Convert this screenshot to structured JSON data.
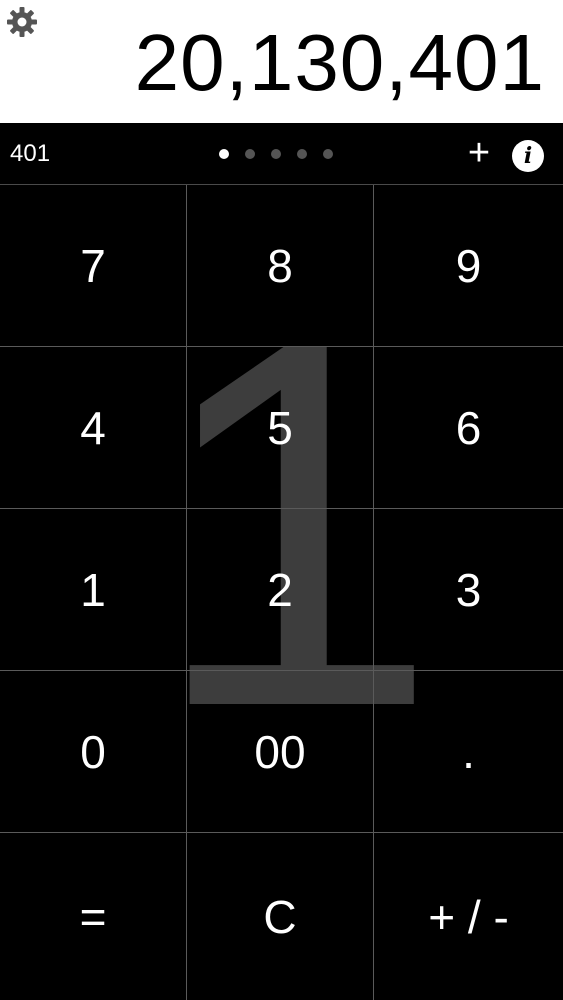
{
  "display": {
    "value": "20,130,401"
  },
  "status_bar": {
    "value": "401",
    "page_count": 5,
    "active_page": 1,
    "add_label": "+",
    "info_label": "i"
  },
  "keypad": {
    "watermark_digit": "1",
    "keys": [
      {
        "name": "key-7",
        "label": "7"
      },
      {
        "name": "key-8",
        "label": "8"
      },
      {
        "name": "key-9",
        "label": "9"
      },
      {
        "name": "key-4",
        "label": "4"
      },
      {
        "name": "key-5",
        "label": "5"
      },
      {
        "name": "key-6",
        "label": "6"
      },
      {
        "name": "key-1",
        "label": "1"
      },
      {
        "name": "key-2",
        "label": "2"
      },
      {
        "name": "key-3",
        "label": "3"
      },
      {
        "name": "key-0",
        "label": "0"
      },
      {
        "name": "key-00",
        "label": "00"
      },
      {
        "name": "key-decimal",
        "label": "."
      },
      {
        "name": "key-equals",
        "label": "="
      },
      {
        "name": "key-clear",
        "label": "C"
      },
      {
        "name": "key-sign",
        "label": "+ / -"
      }
    ]
  },
  "icons": {
    "settings": "gear-icon",
    "info": "info-icon",
    "add": "plus-icon"
  },
  "colors": {
    "background": "#000000",
    "display_background": "#ffffff",
    "grid_line": "#5a5a5a",
    "watermark": "#444444"
  }
}
